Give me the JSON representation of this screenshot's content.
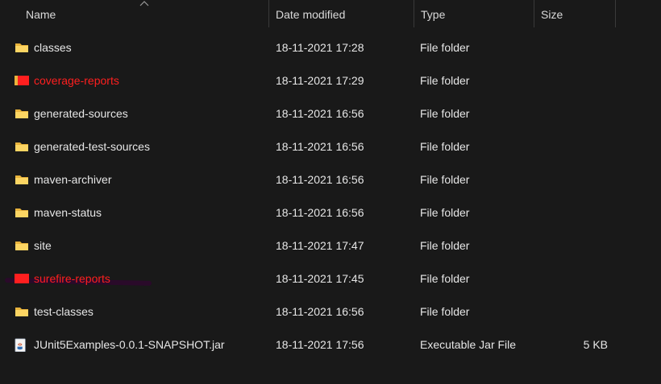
{
  "columns": {
    "name": "Name",
    "date": "Date modified",
    "type": "Type",
    "size": "Size"
  },
  "rows": [
    {
      "name": "classes",
      "date": "18-11-2021 17:28",
      "type": "File folder",
      "size": "",
      "icon": "folder-icon"
    },
    {
      "name": "coverage-reports",
      "date": "18-11-2021 17:29",
      "type": "File folder",
      "size": "",
      "icon": "folder-icon-highlighted"
    },
    {
      "name": "generated-sources",
      "date": "18-11-2021 16:56",
      "type": "File folder",
      "size": "",
      "icon": "folder-icon"
    },
    {
      "name": "generated-test-sources",
      "date": "18-11-2021 16:56",
      "type": "File folder",
      "size": "",
      "icon": "folder-icon"
    },
    {
      "name": "maven-archiver",
      "date": "18-11-2021 16:56",
      "type": "File folder",
      "size": "",
      "icon": "folder-icon"
    },
    {
      "name": "maven-status",
      "date": "18-11-2021 16:56",
      "type": "File folder",
      "size": "",
      "icon": "folder-icon"
    },
    {
      "name": "site",
      "date": "18-11-2021 17:47",
      "type": "File folder",
      "size": "",
      "icon": "folder-icon"
    },
    {
      "name": "surefire-reports",
      "date": "18-11-2021 17:45",
      "type": "File folder",
      "size": "",
      "icon": "folder-icon-highlighted"
    },
    {
      "name": "test-classes",
      "date": "18-11-2021 16:56",
      "type": "File folder",
      "size": "",
      "icon": "folder-icon"
    },
    {
      "name": "JUnit5Examples-0.0.1-SNAPSHOT.jar",
      "date": "18-11-2021 17:56",
      "type": "Executable Jar File",
      "size": "5 KB",
      "icon": "jar-file-icon"
    }
  ],
  "colors": {
    "background": "#191919",
    "text": "#e6e6e6",
    "highlight_text": "#ff1f1f",
    "folder": "#f8c94a",
    "highlight_folder": "#ff1f1f"
  }
}
